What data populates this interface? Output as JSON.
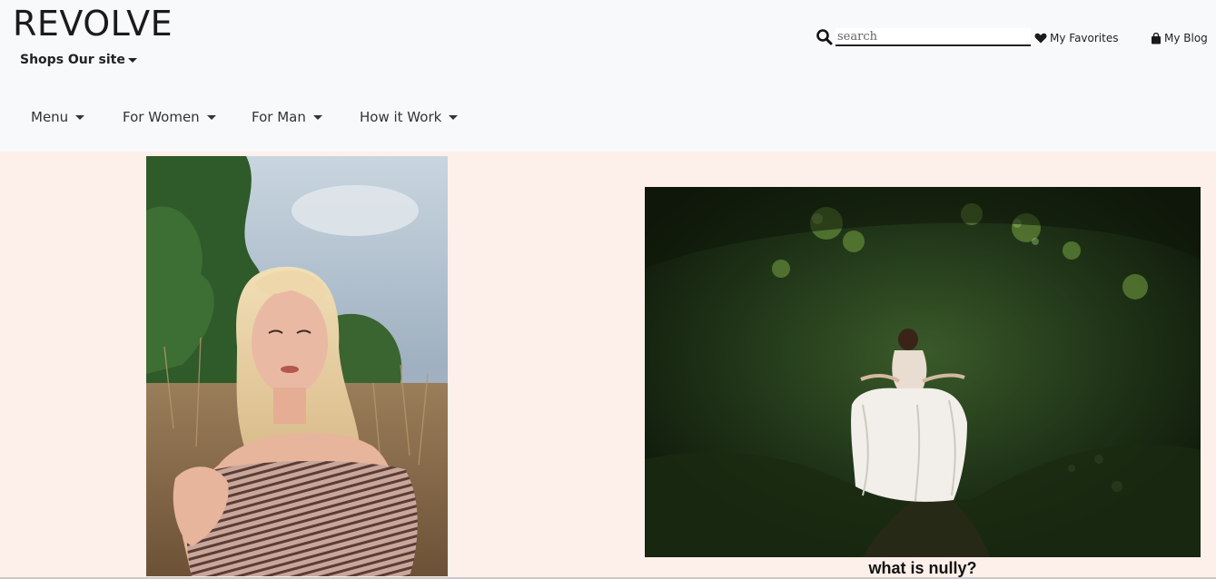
{
  "header": {
    "brand": "REVOLVE",
    "shops_label": "Shops Our site",
    "search": {
      "placeholder": "search",
      "value": ""
    },
    "favorites_label": "My Favorites",
    "blog_label": "My Blog",
    "icons": {
      "search": "search-icon",
      "favorites": "heart-icon",
      "blog": "shopping-bag-icon"
    }
  },
  "nav": {
    "items": [
      {
        "label": "Menu"
      },
      {
        "label": "For Women"
      },
      {
        "label": "For Man"
      },
      {
        "label": "How it Work"
      }
    ]
  },
  "main": {
    "left_image_alt": "blonde woman in striped off-shoulder top in a field",
    "right_image_alt": "woman in white dress walking through green forest",
    "caption": "what is nully?"
  },
  "colors": {
    "header_bg": "#f8f9fa",
    "page_bg": "#fdf0ea",
    "text": "#222222"
  }
}
